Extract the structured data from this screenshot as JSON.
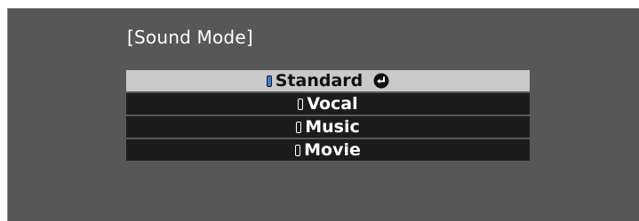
{
  "dialog": {
    "title": "[Sound Mode]"
  },
  "menu": {
    "items": [
      {
        "label": "Standard",
        "selected": true,
        "icon": "enter-icon"
      },
      {
        "label": "Vocal",
        "selected": false
      },
      {
        "label": "Music",
        "selected": false
      },
      {
        "label": "Movie",
        "selected": false
      }
    ]
  },
  "colors": {
    "panel_bg": "#575757",
    "item_bg": "#1c1c1c",
    "selected_bg": "#c9c9c9",
    "selected_indicator": "#3d7bd1"
  }
}
